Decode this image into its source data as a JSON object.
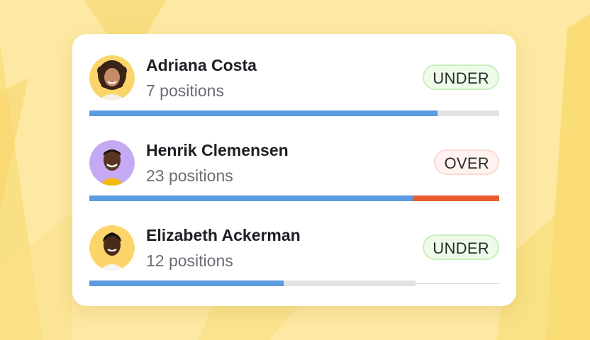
{
  "colors": {
    "background": "#fde9a3",
    "card": "#ffffff",
    "progress_fill": "#5b9be0",
    "progress_track": "#e2e2e2",
    "over_fill": "#e85d2b",
    "under_badge_bg": "#eefbe9",
    "over_badge_bg": "#fff2ef"
  },
  "people": [
    {
      "name": "Adriana Costa",
      "positions": "7 positions",
      "status": "UNDER",
      "avatar_bg": "#fbd56a",
      "progress": 0.85,
      "overflow": 0.0
    },
    {
      "name": "Henrik Clemensen",
      "positions": "23 positions",
      "status": "OVER",
      "avatar_bg": "#c5a9f2",
      "progress": 0.79,
      "overflow": 0.21
    },
    {
      "name": "Elizabeth Ackerman",
      "positions": "12 positions",
      "status": "UNDER",
      "avatar_bg": "#fbd56a",
      "progress": 0.47,
      "overflow": 0.0
    }
  ]
}
